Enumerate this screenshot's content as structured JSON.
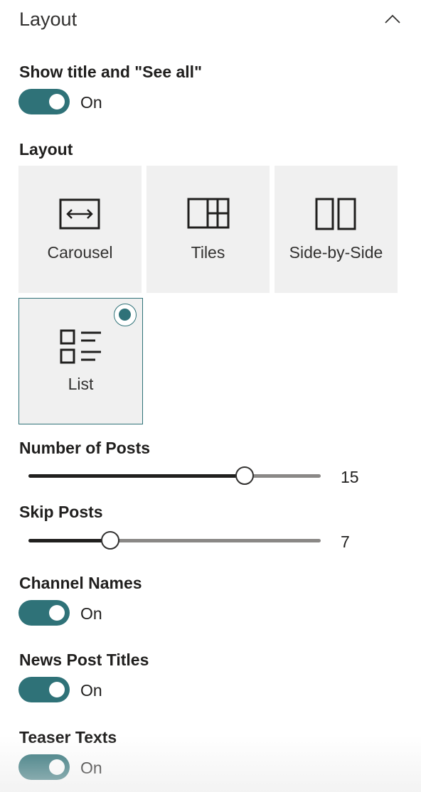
{
  "panel": {
    "title": "Layout",
    "collapse_icon": "chevron-up-icon"
  },
  "show_title": {
    "label": "Show title and \"See all\"",
    "state": "On",
    "checked": true
  },
  "layout": {
    "label": "Layout",
    "options": [
      {
        "label": "Carousel",
        "icon": "carousel-icon",
        "selected": false
      },
      {
        "label": "Tiles",
        "icon": "tiles-icon",
        "selected": false
      },
      {
        "label": "Side-by-Side",
        "icon": "side-by-side-icon",
        "selected": false
      },
      {
        "label": "List",
        "icon": "list-icon",
        "selected": true
      }
    ]
  },
  "number_of_posts": {
    "label": "Number of Posts",
    "value": "15",
    "fraction": 0.74
  },
  "skip_posts": {
    "label": "Skip Posts",
    "value": "7",
    "fraction": 0.28
  },
  "channel_names": {
    "label": "Channel Names",
    "state": "On",
    "checked": true
  },
  "news_post_titles": {
    "label": "News Post Titles",
    "state": "On",
    "checked": true
  },
  "teaser_texts": {
    "label": "Teaser Texts",
    "state": "On",
    "checked": true
  },
  "colors": {
    "accent": "#2f7278",
    "tile_bg": "#f0f0f0",
    "track": "#8a8886",
    "track_fill": "#201f1e"
  }
}
